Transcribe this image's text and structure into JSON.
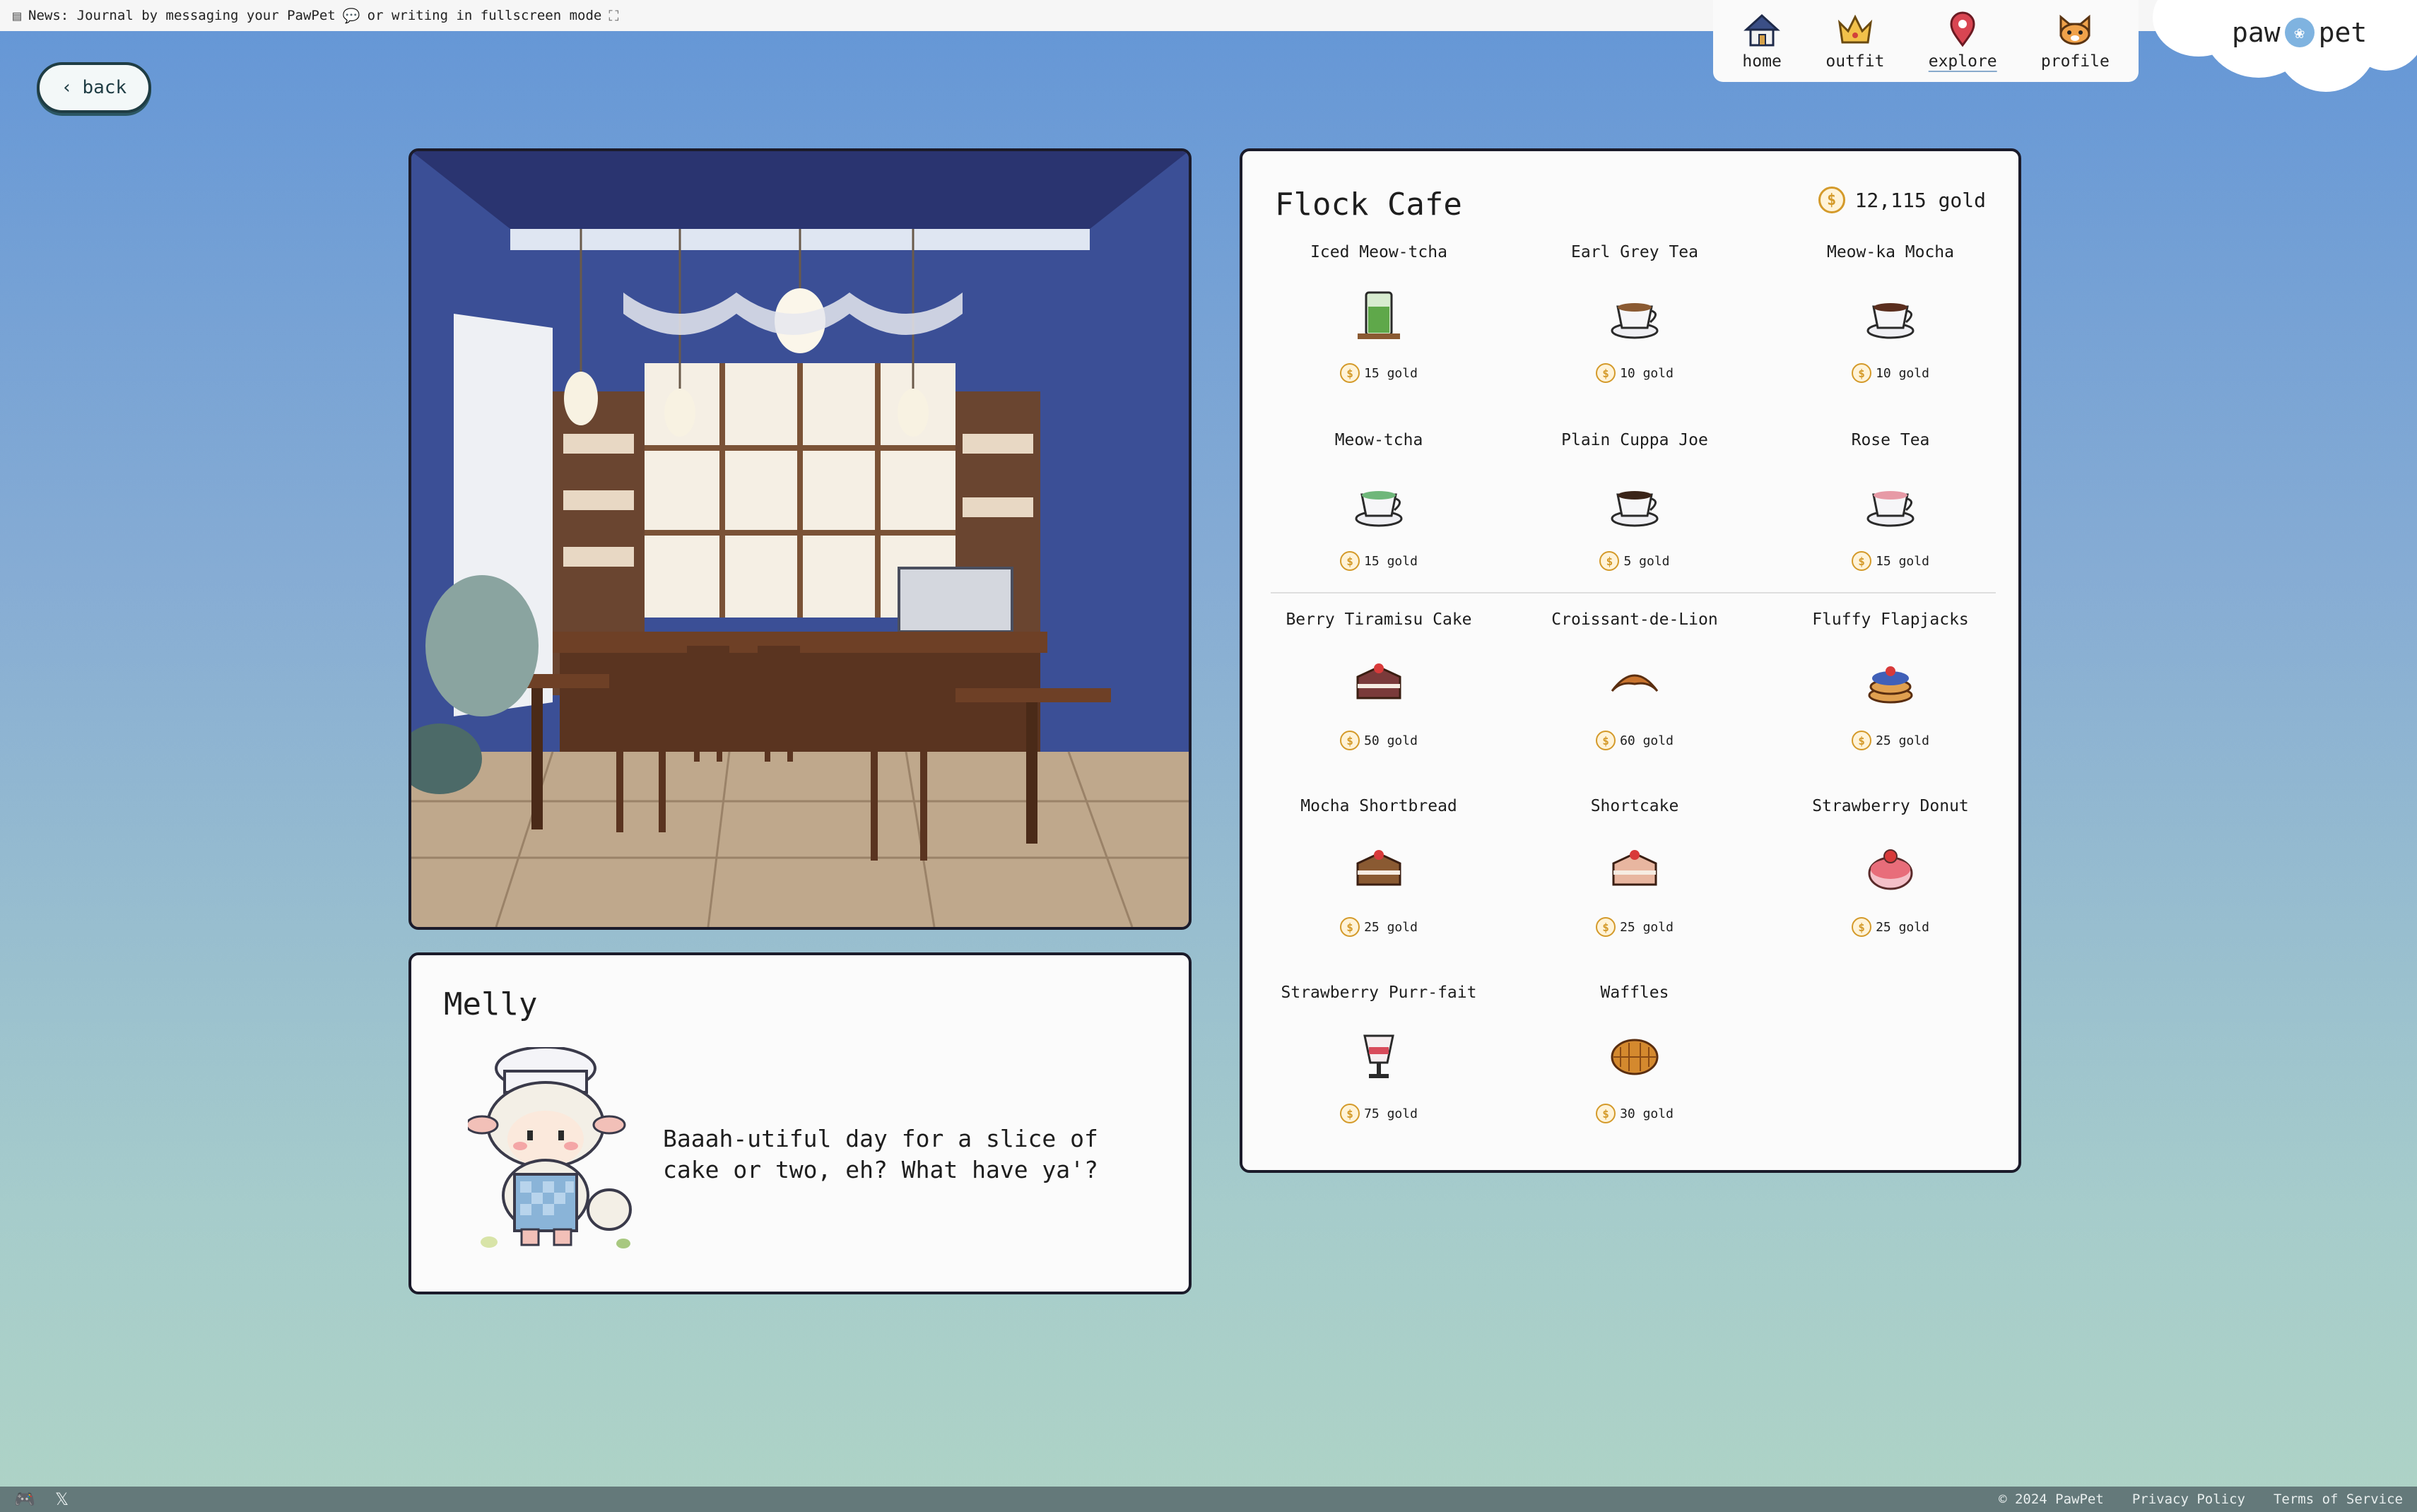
{
  "news": {
    "text": "News: Journal by messaging your PawPet",
    "mid": "or writing in fullscreen mode"
  },
  "back": {
    "label": "back"
  },
  "nav": {
    "items": [
      {
        "label": "home",
        "icon": "house-icon"
      },
      {
        "label": "outfit",
        "icon": "crown-icon"
      },
      {
        "label": "explore",
        "icon": "map-pin-icon"
      },
      {
        "label": "profile",
        "icon": "cat-face-icon"
      }
    ],
    "active": "explore"
  },
  "logo": {
    "left": "paw",
    "right": "pet"
  },
  "npc": {
    "name": "Melly",
    "speech": "Baaah-utiful day for a slice of cake or two, eh? What have ya'?"
  },
  "shop": {
    "title": "Flock Cafe",
    "wallet": "12,115 gold",
    "items": [
      {
        "name": "Iced Meow-tcha",
        "price": "15 gold",
        "icon": "iced-matcha-icon",
        "color": "#5fa84a"
      },
      {
        "name": "Earl Grey Tea",
        "price": "10 gold",
        "icon": "tea-cup-icon",
        "color": "#8a5a32"
      },
      {
        "name": "Meow-ka Mocha",
        "price": "10 gold",
        "icon": "mocha-icon",
        "color": "#5a2e1e"
      },
      {
        "name": "Meow-tcha",
        "price": "15 gold",
        "icon": "matcha-cup-icon",
        "color": "#6fb77a"
      },
      {
        "name": "Plain Cuppa Joe",
        "price": "5 gold",
        "icon": "coffee-cup-icon",
        "color": "#3a2418"
      },
      {
        "name": "Rose Tea",
        "price": "15 gold",
        "icon": "rose-tea-icon",
        "color": "#e79aa6"
      },
      {
        "name": "Berry Tiramisu Cake",
        "price": "50 gold",
        "icon": "tiramisu-icon",
        "color": "#7a3a3a"
      },
      {
        "name": "Croissant-de-Lion",
        "price": "60 gold",
        "icon": "croissant-icon",
        "color": "#c9742e"
      },
      {
        "name": "Fluffy Flapjacks",
        "price": "25 gold",
        "icon": "pancakes-icon",
        "color": "#4060b8"
      },
      {
        "name": "Mocha Shortbread",
        "price": "25 gold",
        "icon": "shortbread-icon",
        "color": "#8a5a32"
      },
      {
        "name": "Shortcake",
        "price": "25 gold",
        "icon": "shortcake-icon",
        "color": "#e8b6a0"
      },
      {
        "name": "Strawberry Donut",
        "price": "25 gold",
        "icon": "donut-icon",
        "color": "#e86d7a"
      },
      {
        "name": "Strawberry Purr-fait",
        "price": "75 gold",
        "icon": "parfait-icon",
        "color": "#d84a5a"
      },
      {
        "name": "Waffles",
        "price": "30 gold",
        "icon": "waffle-icon",
        "color": "#d4892e"
      }
    ]
  },
  "footer": {
    "copyright": "© 2024 PawPet",
    "privacy": "Privacy Policy",
    "terms": "Terms of Service"
  }
}
